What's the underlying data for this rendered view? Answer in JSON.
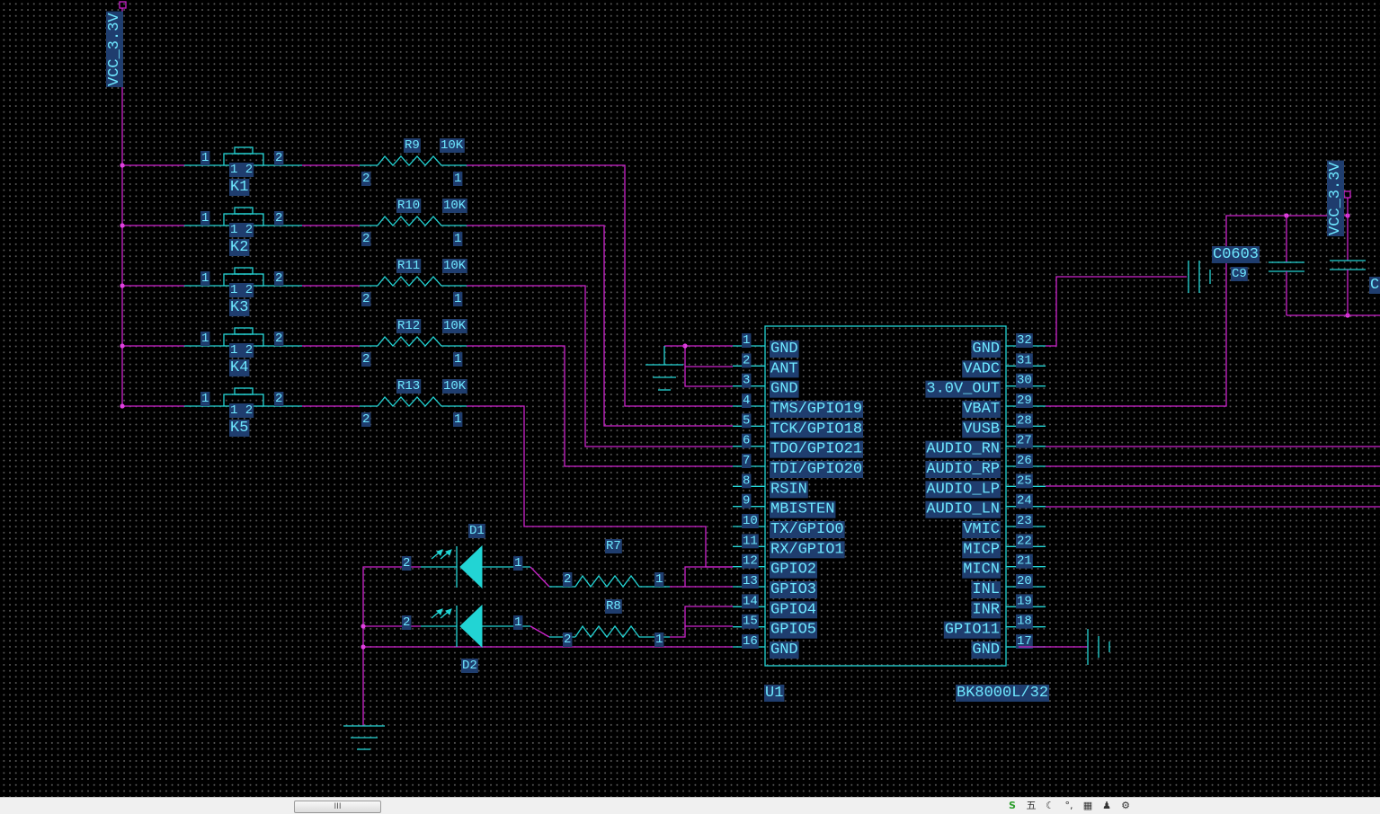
{
  "power": {
    "vcc_left": "VCC_3.3V",
    "vcc_right": "VCC_3.3V"
  },
  "switches": [
    {
      "ref": "K1",
      "pin_left": "1",
      "pin_right": "2",
      "inner": "1 2"
    },
    {
      "ref": "K2",
      "pin_left": "1",
      "pin_right": "2",
      "inner": "1 2"
    },
    {
      "ref": "K3",
      "pin_left": "1",
      "pin_right": "2",
      "inner": "1 2"
    },
    {
      "ref": "K4",
      "pin_left": "1",
      "pin_right": "2",
      "inner": "1 2"
    },
    {
      "ref": "K5",
      "pin_left": "1",
      "pin_right": "2",
      "inner": "1 2"
    }
  ],
  "resistors_pullup": [
    {
      "ref": "R9",
      "value": "10K",
      "pin_left": "2",
      "pin_right": "1"
    },
    {
      "ref": "R10",
      "value": "10K",
      "pin_left": "2",
      "pin_right": "1"
    },
    {
      "ref": "R11",
      "value": "10K",
      "pin_left": "2",
      "pin_right": "1"
    },
    {
      "ref": "R12",
      "value": "10K",
      "pin_left": "2",
      "pin_right": "1"
    },
    {
      "ref": "R13",
      "value": "10K",
      "pin_left": "2",
      "pin_right": "1"
    }
  ],
  "leds": [
    {
      "ref": "D1",
      "pin_left": "2",
      "pin_right": "1"
    },
    {
      "ref": "D2",
      "pin_left": "2",
      "pin_right": "1"
    }
  ],
  "resistors_led": [
    {
      "ref": "R7",
      "pin_left": "2",
      "pin_right": "1"
    },
    {
      "ref": "R8",
      "pin_left": "2",
      "pin_right": "1"
    }
  ],
  "capacitor": {
    "package": "C0603",
    "ref": "C9",
    "edge_label": "C"
  },
  "ic": {
    "ref": "U1",
    "part": "BK8000L/32",
    "left_pins": [
      {
        "num": "1",
        "name": "GND"
      },
      {
        "num": "2",
        "name": "ANT"
      },
      {
        "num": "3",
        "name": "GND"
      },
      {
        "num": "4",
        "name": "TMS/GPIO19"
      },
      {
        "num": "5",
        "name": "TCK/GPIO18"
      },
      {
        "num": "6",
        "name": "TDO/GPIO21"
      },
      {
        "num": "7",
        "name": "TDI/GPIO20"
      },
      {
        "num": "8",
        "name": "RSIN"
      },
      {
        "num": "9",
        "name": "MBISTEN"
      },
      {
        "num": "10",
        "name": "TX/GPIO0"
      },
      {
        "num": "11",
        "name": "RX/GPIO1"
      },
      {
        "num": "12",
        "name": "GPIO2"
      },
      {
        "num": "13",
        "name": "GPIO3"
      },
      {
        "num": "14",
        "name": "GPIO4"
      },
      {
        "num": "15",
        "name": "GPIO5"
      },
      {
        "num": "16",
        "name": "GND"
      }
    ],
    "right_pins": [
      {
        "num": "32",
        "name": "GND"
      },
      {
        "num": "31",
        "name": "VADC"
      },
      {
        "num": "30",
        "name": "3.0V_OUT"
      },
      {
        "num": "29",
        "name": "VBAT"
      },
      {
        "num": "28",
        "name": "VUSB"
      },
      {
        "num": "27",
        "name": "AUDIO_RN"
      },
      {
        "num": "26",
        "name": "AUDIO_RP"
      },
      {
        "num": "25",
        "name": "AUDIO_LP"
      },
      {
        "num": "24",
        "name": "AUDIO_LN"
      },
      {
        "num": "23",
        "name": "VMIC"
      },
      {
        "num": "22",
        "name": "MICP"
      },
      {
        "num": "21",
        "name": "MICN"
      },
      {
        "num": "20",
        "name": "INL"
      },
      {
        "num": "19",
        "name": "INR"
      },
      {
        "num": "18",
        "name": "GPIO11"
      },
      {
        "num": "17",
        "name": "GND"
      }
    ]
  },
  "scrollbar": {
    "grip": "III"
  },
  "colors": {
    "wire": "#cc22cc",
    "component": "#22d4d4",
    "text": "#6ee8ff",
    "junction": "#e040e0",
    "background": "#000000"
  }
}
